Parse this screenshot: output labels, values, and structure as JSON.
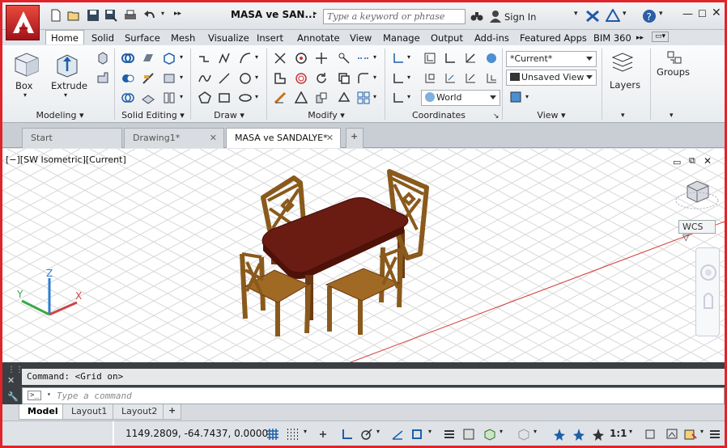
{
  "window": {
    "doc_title": "MASA ve SAN...",
    "search_placeholder": "Type a keyword or phrase",
    "sign_in": "Sign In"
  },
  "ribbon_tabs": [
    "Home",
    "Solid",
    "Surface",
    "Mesh",
    "Visualize",
    "Insert",
    "Annotate",
    "View",
    "Manage",
    "Output",
    "Add-ins",
    "Featured Apps",
    "BIM 360"
  ],
  "active_ribbon_tab": "Home",
  "ribbon": {
    "box_label": "Box",
    "extrude_label": "Extrude",
    "panels": {
      "modeling": "Modeling",
      "solid_editing": "Solid Editing",
      "draw": "Draw",
      "modify": "Modify",
      "coordinates": "Coordinates",
      "view": "View"
    },
    "visual_style": "*Current*",
    "view_dropdown": "Unsaved View",
    "ucs_dropdown": "World",
    "layers_label": "Layers",
    "groups_label": "Groups"
  },
  "file_tabs": [
    {
      "label": "Start",
      "active": false
    },
    {
      "label": "Drawing1*",
      "active": false
    },
    {
      "label": "MASA ve SANDALYE*",
      "active": true
    }
  ],
  "viewport": {
    "label": "[−][SW Isometric][Current]",
    "wcs": "WCS",
    "axis_x": "X",
    "axis_y": "Y",
    "axis_z": "Z"
  },
  "command": {
    "history": "Command:  <Grid on>",
    "placeholder": "Type a command"
  },
  "layout_tabs": [
    "Model",
    "Layout1",
    "Layout2"
  ],
  "status": {
    "coordinates": "1149.2809, -64.7437, 0.0000",
    "scale": "1:1"
  },
  "colors": {
    "frame": "#e0242a",
    "wood": "#8a5a1c",
    "tabletop": "#6a1b12"
  }
}
